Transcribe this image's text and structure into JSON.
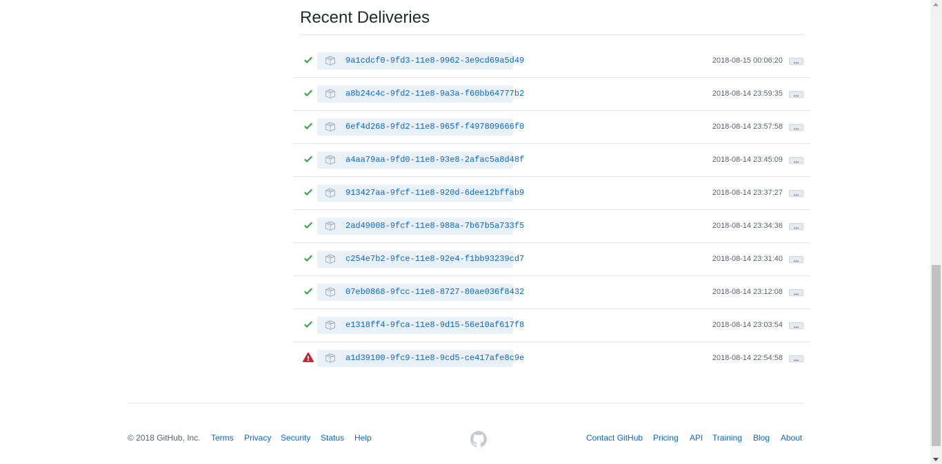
{
  "section": {
    "title": "Recent Deliveries"
  },
  "deliveries": [
    {
      "status": "success",
      "guid": "9a1cdcf0-9fd3-11e8-9962-3e9cd69a5d49",
      "time": "2018-08-15 00:06:20"
    },
    {
      "status": "success",
      "guid": "a8b24c4c-9fd2-11e8-9a3a-f60bb64777b2",
      "time": "2018-08-14 23:59:35"
    },
    {
      "status": "success",
      "guid": "6ef4d268-9fd2-11e8-965f-f497809666f0",
      "time": "2018-08-14 23:57:58"
    },
    {
      "status": "success",
      "guid": "a4aa79aa-9fd0-11e8-93e8-2afac5a8d48f",
      "time": "2018-08-14 23:45:09"
    },
    {
      "status": "success",
      "guid": "913427aa-9fcf-11e8-920d-6dee12bffab9",
      "time": "2018-08-14 23:37:27"
    },
    {
      "status": "success",
      "guid": "2ad49008-9fcf-11e8-988a-7b67b5a733f5",
      "time": "2018-08-14 23:34:36"
    },
    {
      "status": "success",
      "guid": "c254e7b2-9fce-11e8-92e4-f1bb93239cd7",
      "time": "2018-08-14 23:31:40"
    },
    {
      "status": "success",
      "guid": "07eb0868-9fcc-11e8-8727-80ae036f8432",
      "time": "2018-08-14 23:12:08"
    },
    {
      "status": "success",
      "guid": "e1318ff4-9fca-11e8-9d15-56e10af617f8",
      "time": "2018-08-14 23:03:54"
    },
    {
      "status": "failure",
      "guid": "a1d39100-9fc9-11e8-9cd5-ce417afe8c9e",
      "time": "2018-08-14 22:54:58"
    }
  ],
  "more_label": "...",
  "footer": {
    "copyright": "© 2018 GitHub, Inc.",
    "left_links": [
      "Terms",
      "Privacy",
      "Security",
      "Status",
      "Help"
    ],
    "right_links": [
      "Contact GitHub",
      "Pricing",
      "API",
      "Training",
      "Blog",
      "About"
    ],
    "logo_icon": "octocat-icon"
  },
  "colors": {
    "success": "#28a745",
    "failure": "#cb2431",
    "link": "#0366d6",
    "guid_bg": "#eaf1f8"
  },
  "icons": {
    "success": "check-icon",
    "failure": "alert-icon",
    "delivery": "package-icon"
  }
}
